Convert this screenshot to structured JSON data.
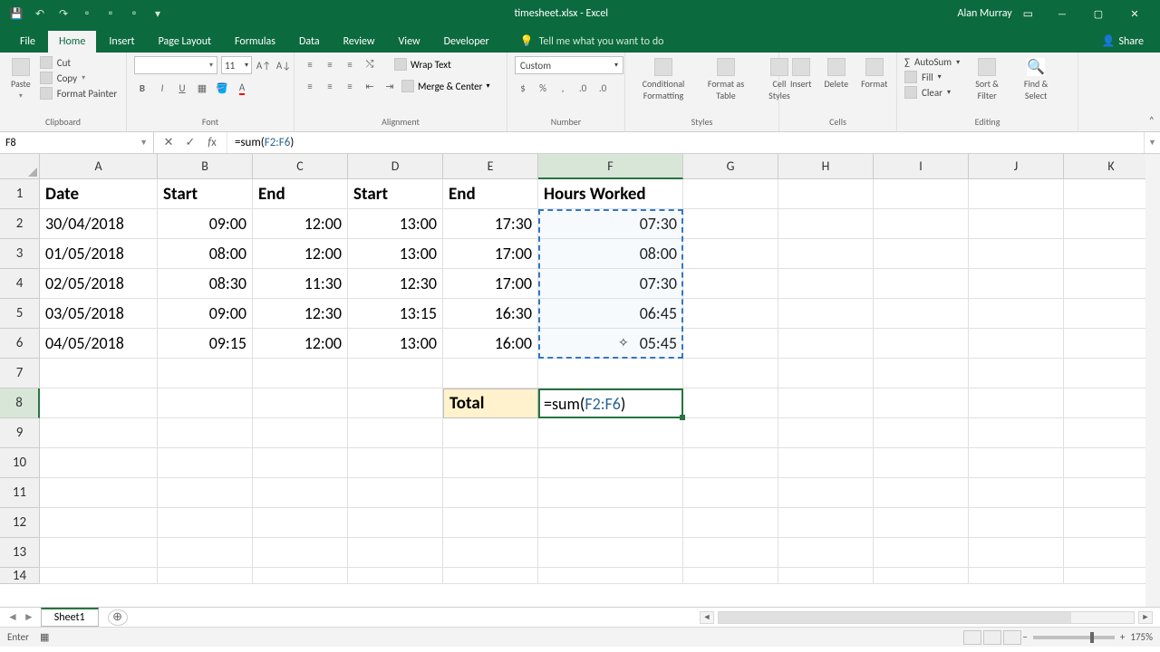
{
  "titlebar": {
    "doc": "timesheet.xlsx - Excel",
    "user": "Alan Murray"
  },
  "tabs": [
    "File",
    "Home",
    "Insert",
    "Page Layout",
    "Formulas",
    "Data",
    "Review",
    "View",
    "Developer"
  ],
  "tell_me": "Tell me what you want to do",
  "share": "Share",
  "ribbon": {
    "clipboard": {
      "paste": "Paste",
      "cut": "Cut",
      "copy": "Copy",
      "fmt": "Format Painter",
      "label": "Clipboard"
    },
    "font": {
      "size": "11",
      "label": "Font"
    },
    "alignment": {
      "wrap": "Wrap Text",
      "merge": "Merge & Center",
      "label": "Alignment"
    },
    "number": {
      "format": "Custom",
      "label": "Number"
    },
    "styles": {
      "cf": "Conditional Formatting",
      "ft": "Format as Table",
      "cs": "Cell Styles",
      "label": "Styles"
    },
    "cells": {
      "ins": "Insert",
      "del": "Delete",
      "fmt": "Format",
      "label": "Cells"
    },
    "editing": {
      "sum": "AutoSum",
      "fill": "Fill",
      "clear": "Clear",
      "sort": "Sort & Filter",
      "find": "Find & Select",
      "label": "Editing"
    }
  },
  "namebox": "F8",
  "formula": {
    "prefix": "=sum(",
    "range": "F2:F6",
    "suffix": ")"
  },
  "columns": [
    "A",
    "B",
    "C",
    "D",
    "E",
    "F",
    "G",
    "H",
    "I",
    "J",
    "K"
  ],
  "headers": {
    "A": "Date",
    "B": "Start",
    "C": "End",
    "D": "Start",
    "E": "End",
    "F": "Hours Worked"
  },
  "rows": [
    {
      "A": "30/04/2018",
      "B": "09:00",
      "C": "12:00",
      "D": "13:00",
      "E": "17:30",
      "F": "07:30"
    },
    {
      "A": "01/05/2018",
      "B": "08:00",
      "C": "12:00",
      "D": "13:00",
      "E": "17:00",
      "F": "08:00"
    },
    {
      "A": "02/05/2018",
      "B": "08:30",
      "C": "11:30",
      "D": "12:30",
      "E": "17:00",
      "F": "07:30"
    },
    {
      "A": "03/05/2018",
      "B": "09:00",
      "C": "12:30",
      "D": "13:15",
      "E": "16:30",
      "F": "06:45"
    },
    {
      "A": "04/05/2018",
      "B": "09:15",
      "C": "12:00",
      "D": "13:00",
      "E": "16:00",
      "F": "05:45"
    }
  ],
  "total_label": "Total",
  "edit_formula": {
    "prefix": "=sum(",
    "range": "F2:F6",
    "suffix": ")"
  },
  "sheet": "Sheet1",
  "status_mode": "Enter",
  "zoom": "175%"
}
